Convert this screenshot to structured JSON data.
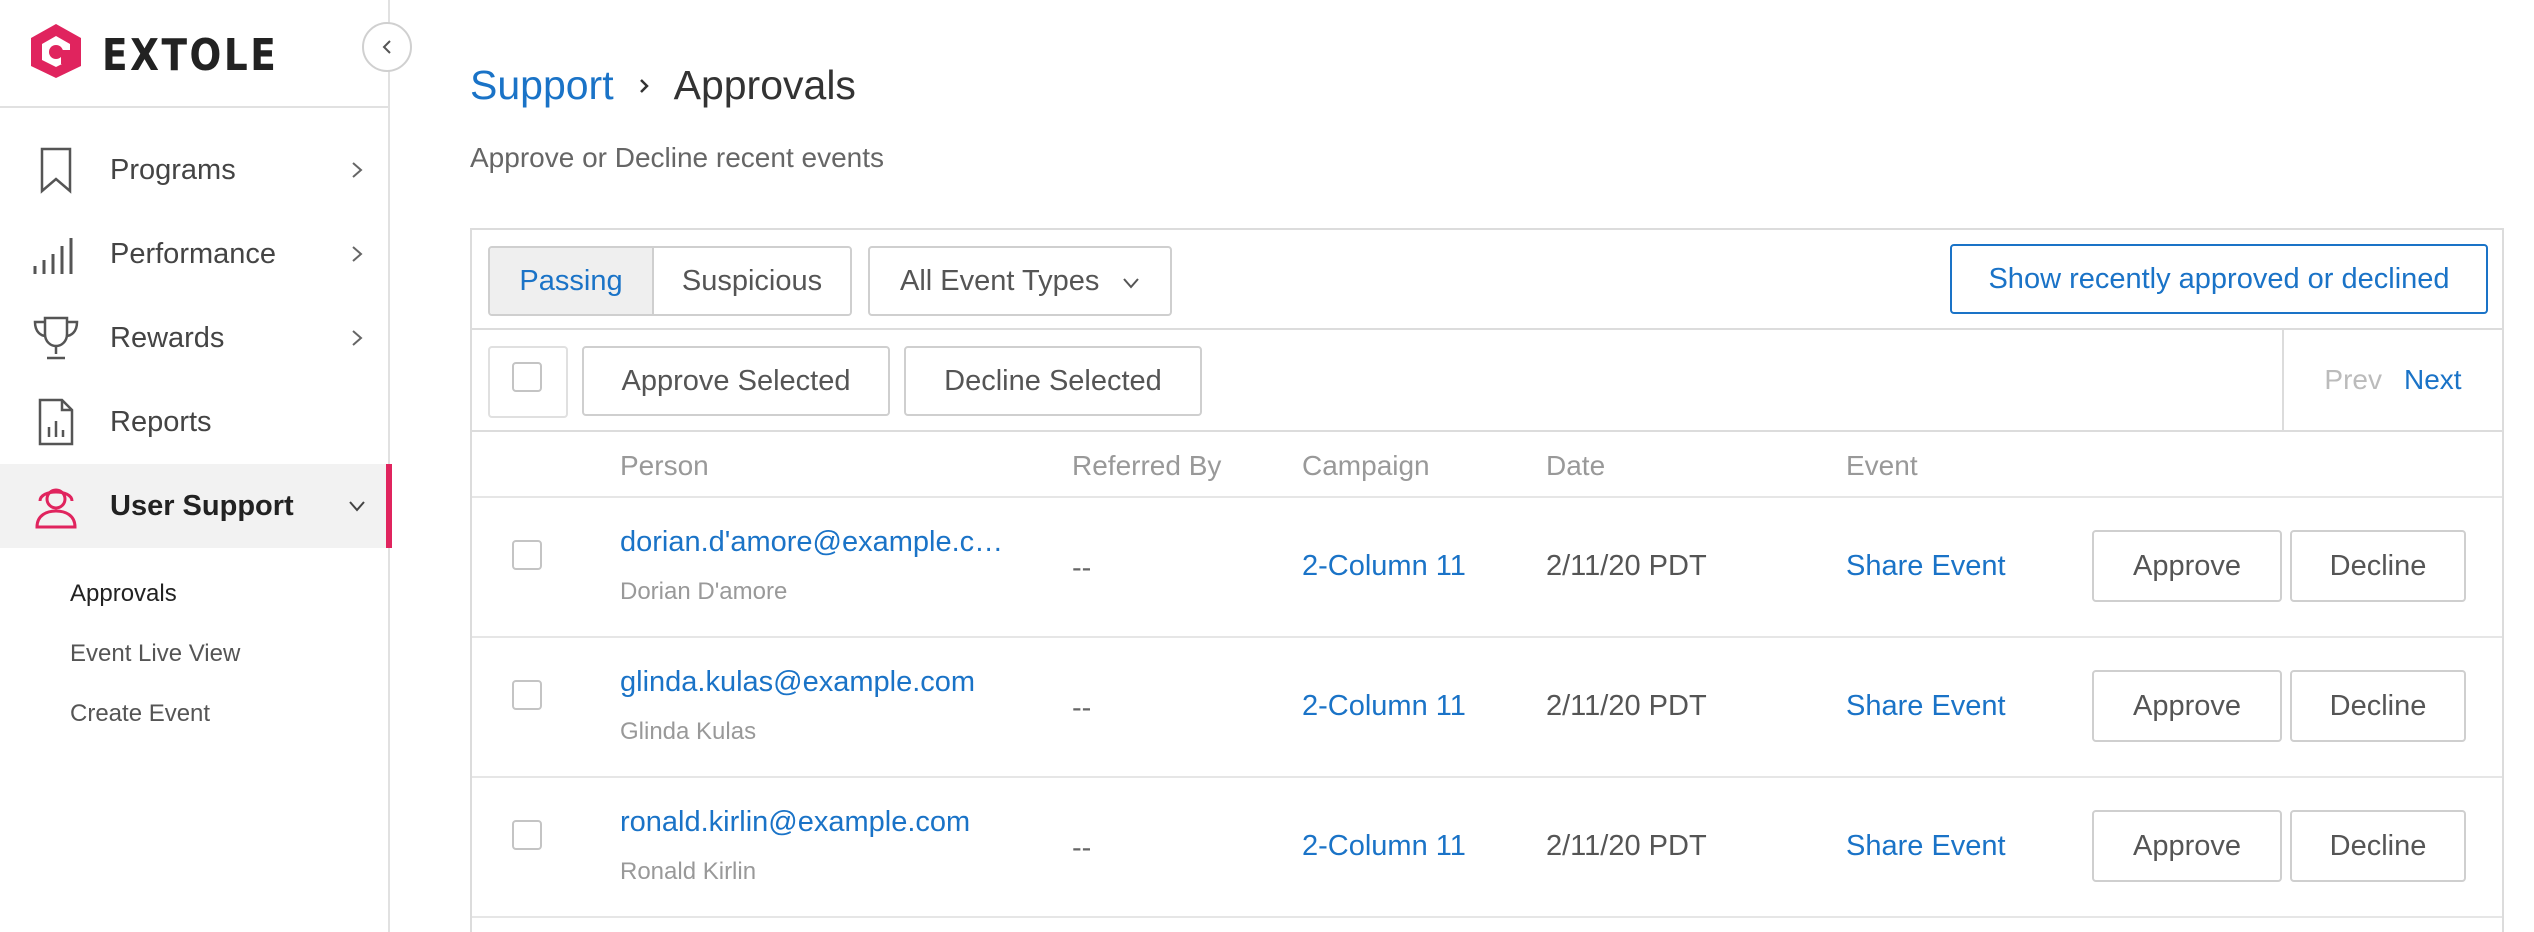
{
  "brand": {
    "name": "EXTOLE",
    "accent": "#e0245e",
    "link_color": "#1a73c7"
  },
  "sidebar": {
    "items": [
      {
        "label": "Programs",
        "icon": "bookmark-icon",
        "has_chevron": true
      },
      {
        "label": "Performance",
        "icon": "bar-chart-icon",
        "has_chevron": true
      },
      {
        "label": "Rewards",
        "icon": "trophy-icon",
        "has_chevron": true
      },
      {
        "label": "Reports",
        "icon": "report-document-icon",
        "has_chevron": false
      },
      {
        "label": "User Support",
        "icon": "support-headset-icon",
        "has_chevron": true,
        "active": true,
        "expanded": true
      }
    ],
    "subitems": [
      {
        "label": "Approvals",
        "current": true
      },
      {
        "label": "Event Live View"
      },
      {
        "label": "Create Event"
      }
    ]
  },
  "page": {
    "breadcrumb_parent": "Support",
    "breadcrumb_current": "Approvals",
    "subtitle": "Approve or Decline recent events"
  },
  "toolbar": {
    "tabs": [
      {
        "label": "Passing",
        "active": true
      },
      {
        "label": "Suspicious"
      }
    ],
    "event_type_filter": "All Event Types",
    "show_recent_label": "Show recently approved or declined",
    "approve_selected_label": "Approve Selected",
    "decline_selected_label": "Decline Selected",
    "prev_label": "Prev",
    "next_label": "Next"
  },
  "table": {
    "columns": [
      "Person",
      "Referred By",
      "Campaign",
      "Date",
      "Event"
    ],
    "rows": [
      {
        "email": "dorian.d'amore@example.c…",
        "name": "Dorian D'amore",
        "referred_by": "--",
        "campaign": "2-Column 11",
        "date": "2/11/20 PDT",
        "event": "Share Event",
        "approve": "Approve",
        "decline": "Decline"
      },
      {
        "email": "glinda.kulas@example.com",
        "name": "Glinda Kulas",
        "referred_by": "--",
        "campaign": "2-Column 11",
        "date": "2/11/20 PDT",
        "event": "Share Event",
        "approve": "Approve",
        "decline": "Decline"
      },
      {
        "email": "ronald.kirlin@example.com",
        "name": "Ronald Kirlin",
        "referred_by": "--",
        "campaign": "2-Column 11",
        "date": "2/11/20 PDT",
        "event": "Share Event",
        "approve": "Approve",
        "decline": "Decline"
      }
    ]
  }
}
